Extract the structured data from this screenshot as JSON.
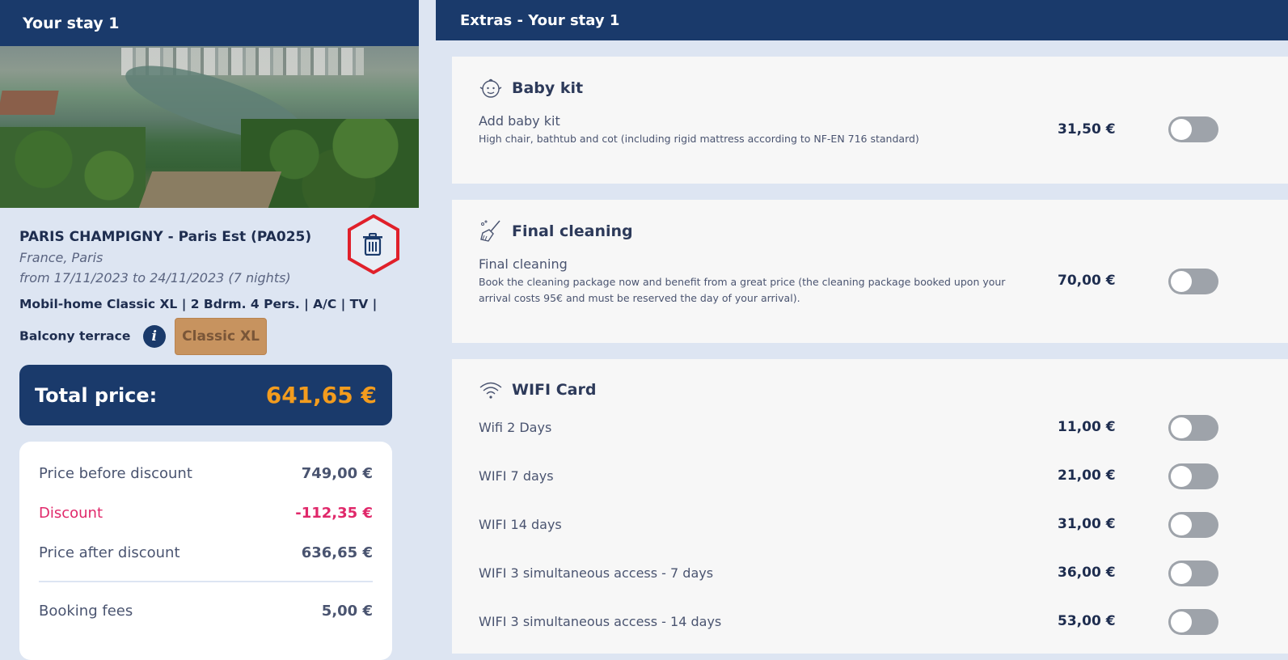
{
  "left": {
    "header": "Your stay 1",
    "camp_name": "PARIS CHAMPIGNY - Paris Est (PA025)",
    "location": "France, Paris",
    "dates": "from 17/11/2023 to 24/11/2023 (7 nights)",
    "unit_line1": "Mobil-home Classic XL | 2 Bdrm. 4 Pers. | A/C | TV |",
    "unit_line2": "Balcony terrace",
    "unit_badge": "Classic XL",
    "total_label": "Total price:",
    "total_value": "641,65 €",
    "prices": [
      {
        "label": "Price before discount",
        "value": "749,00 €"
      },
      {
        "label": "Discount",
        "value": "-112,35 €"
      },
      {
        "label": "Price after discount",
        "value": "636,65 €"
      },
      {
        "label": "Booking fees",
        "value": "5,00 €"
      }
    ]
  },
  "right": {
    "header": "Extras - Your stay 1",
    "baby": {
      "title": "Baby kit",
      "name": "Add baby kit",
      "desc": "High chair, bathtub and cot (including rigid mattress according to NF-EN 716 standard)",
      "price": "31,50 €"
    },
    "cleaning": {
      "title": "Final cleaning",
      "name": "Final cleaning",
      "desc": "Book the cleaning package now and benefit from a great price (the cleaning package booked upon your arrival costs 95€ and must be reserved the day of your arrival).",
      "price": "70,00 €"
    },
    "wifi": {
      "title": "WIFI Card",
      "options": [
        {
          "name": "Wifi 2 Days",
          "price": "11,00 €"
        },
        {
          "name": "WIFI 7 days",
          "price": "21,00 €"
        },
        {
          "name": "WIFI 14 days",
          "price": "31,00 €"
        },
        {
          "name": "WIFI 3 simultaneous access - 7 days",
          "price": "36,00 €"
        },
        {
          "name": "WIFI 3 simultaneous access - 14 days",
          "price": "53,00 €"
        }
      ]
    }
  },
  "colors": {
    "navy": "#1a3a6b",
    "total_accent": "#f39c1e",
    "discount": "#e0286a",
    "highlight": "#e0202a",
    "toggle_off": "#9ea3aa"
  }
}
